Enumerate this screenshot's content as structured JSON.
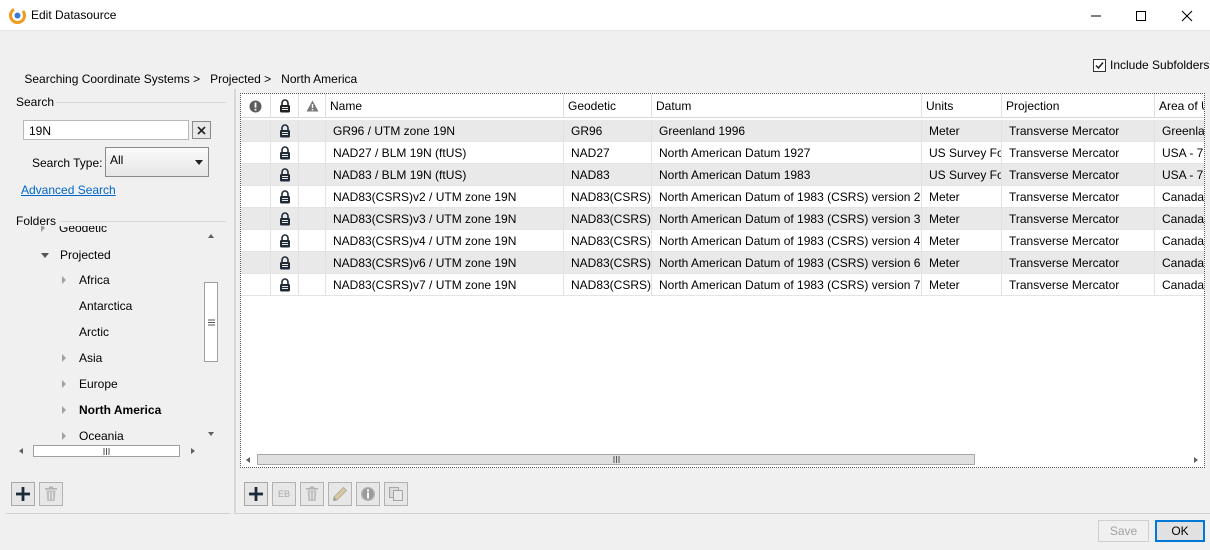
{
  "window": {
    "title": "Edit Datasource",
    "minimize_icon": "minimize-icon",
    "maximize_icon": "maximize-icon",
    "close_icon": "close-icon"
  },
  "breadcrumb": {
    "items": [
      "Searching Coordinate Systems >",
      "Projected >",
      "North America"
    ]
  },
  "include_subfolders": {
    "label": "Include Subfolders",
    "checked": true
  },
  "search": {
    "group_label": "Search",
    "value": "19N",
    "type_label": "Search Type:",
    "type_value": "All",
    "advanced_link": "Advanced Search"
  },
  "folders": {
    "group_label": "Folders",
    "items": [
      {
        "label": "Geodetic",
        "level": 1,
        "expander": "right",
        "bold": false
      },
      {
        "label": "Projected",
        "level": 1,
        "expander": "down",
        "bold": false
      },
      {
        "label": "Africa",
        "level": 2,
        "expander": "right",
        "bold": false
      },
      {
        "label": "Antarctica",
        "level": 2,
        "expander": "none",
        "bold": false
      },
      {
        "label": "Arctic",
        "level": 2,
        "expander": "none",
        "bold": false
      },
      {
        "label": "Asia",
        "level": 2,
        "expander": "right",
        "bold": false
      },
      {
        "label": "Europe",
        "level": 2,
        "expander": "right",
        "bold": false
      },
      {
        "label": "North America",
        "level": 2,
        "expander": "right",
        "bold": true
      },
      {
        "label": "Oceania",
        "level": 2,
        "expander": "right",
        "bold": false
      }
    ]
  },
  "grid": {
    "columns": [
      "Name",
      "Geodetic",
      "Datum",
      "Units",
      "Projection",
      "Area of U"
    ],
    "header_icons": [
      "exclamation-icon",
      "lock-icon",
      "warning-icon"
    ],
    "rows": [
      {
        "name": "GR96 / UTM zone 19N",
        "geodetic": "GR96",
        "datum": "Greenland 1996",
        "units": "Meter",
        "projection": "Transverse Mercator",
        "area": "Greenlar"
      },
      {
        "name": "NAD27 / BLM 19N (ftUS)",
        "geodetic": "NAD27",
        "datum": "North American Datum 1927",
        "units": "US Survey Fo",
        "projection": "Transverse Mercator",
        "area": "USA - 72"
      },
      {
        "name": "NAD83 / BLM 19N (ftUS)",
        "geodetic": "NAD83",
        "datum": "North American Datum 1983",
        "units": "US Survey Fo",
        "projection": "Transverse Mercator",
        "area": "USA - 72"
      },
      {
        "name": "NAD83(CSRS)v2 / UTM zone 19N",
        "geodetic": "NAD83(CSRS)\\",
        "datum": "North American Datum of 1983 (CSRS) version 2",
        "units": "Meter",
        "projection": "Transverse Mercator",
        "area": "Canada -"
      },
      {
        "name": "NAD83(CSRS)v3 / UTM zone 19N",
        "geodetic": "NAD83(CSRS)\\",
        "datum": "North American Datum of 1983 (CSRS) version 3",
        "units": "Meter",
        "projection": "Transverse Mercator",
        "area": "Canada -"
      },
      {
        "name": "NAD83(CSRS)v4 / UTM zone 19N",
        "geodetic": "NAD83(CSRS)\\",
        "datum": "North American Datum of 1983 (CSRS) version 4",
        "units": "Meter",
        "projection": "Transverse Mercator",
        "area": "Canada -"
      },
      {
        "name": "NAD83(CSRS)v6 / UTM zone 19N",
        "geodetic": "NAD83(CSRS)\\",
        "datum": "North American Datum of 1983 (CSRS) version 6",
        "units": "Meter",
        "projection": "Transverse Mercator",
        "area": "Canada -"
      },
      {
        "name": "NAD83(CSRS)v7 / UTM zone 19N",
        "geodetic": "NAD83(CSRS)\\",
        "datum": "North American Datum of 1983 (CSRS) version 7",
        "units": "Meter",
        "projection": "Transverse Mercator",
        "area": "Canada -"
      }
    ]
  },
  "toolbar_left": {
    "add_icon": "plus-icon",
    "delete_icon": "trash-icon"
  },
  "toolbar_grid": {
    "add_icon": "plus-icon",
    "eb_label": "EB",
    "delete_icon": "trash-icon",
    "edit_icon": "pencil-icon",
    "info_icon": "info-icon",
    "copy_icon": "copy-icon"
  },
  "footer": {
    "save_label": "Save",
    "ok_label": "OK"
  },
  "colors": {
    "link": "#0066cc",
    "row_shade": "#e9e9e9",
    "default_button_border": "#0078d7"
  }
}
